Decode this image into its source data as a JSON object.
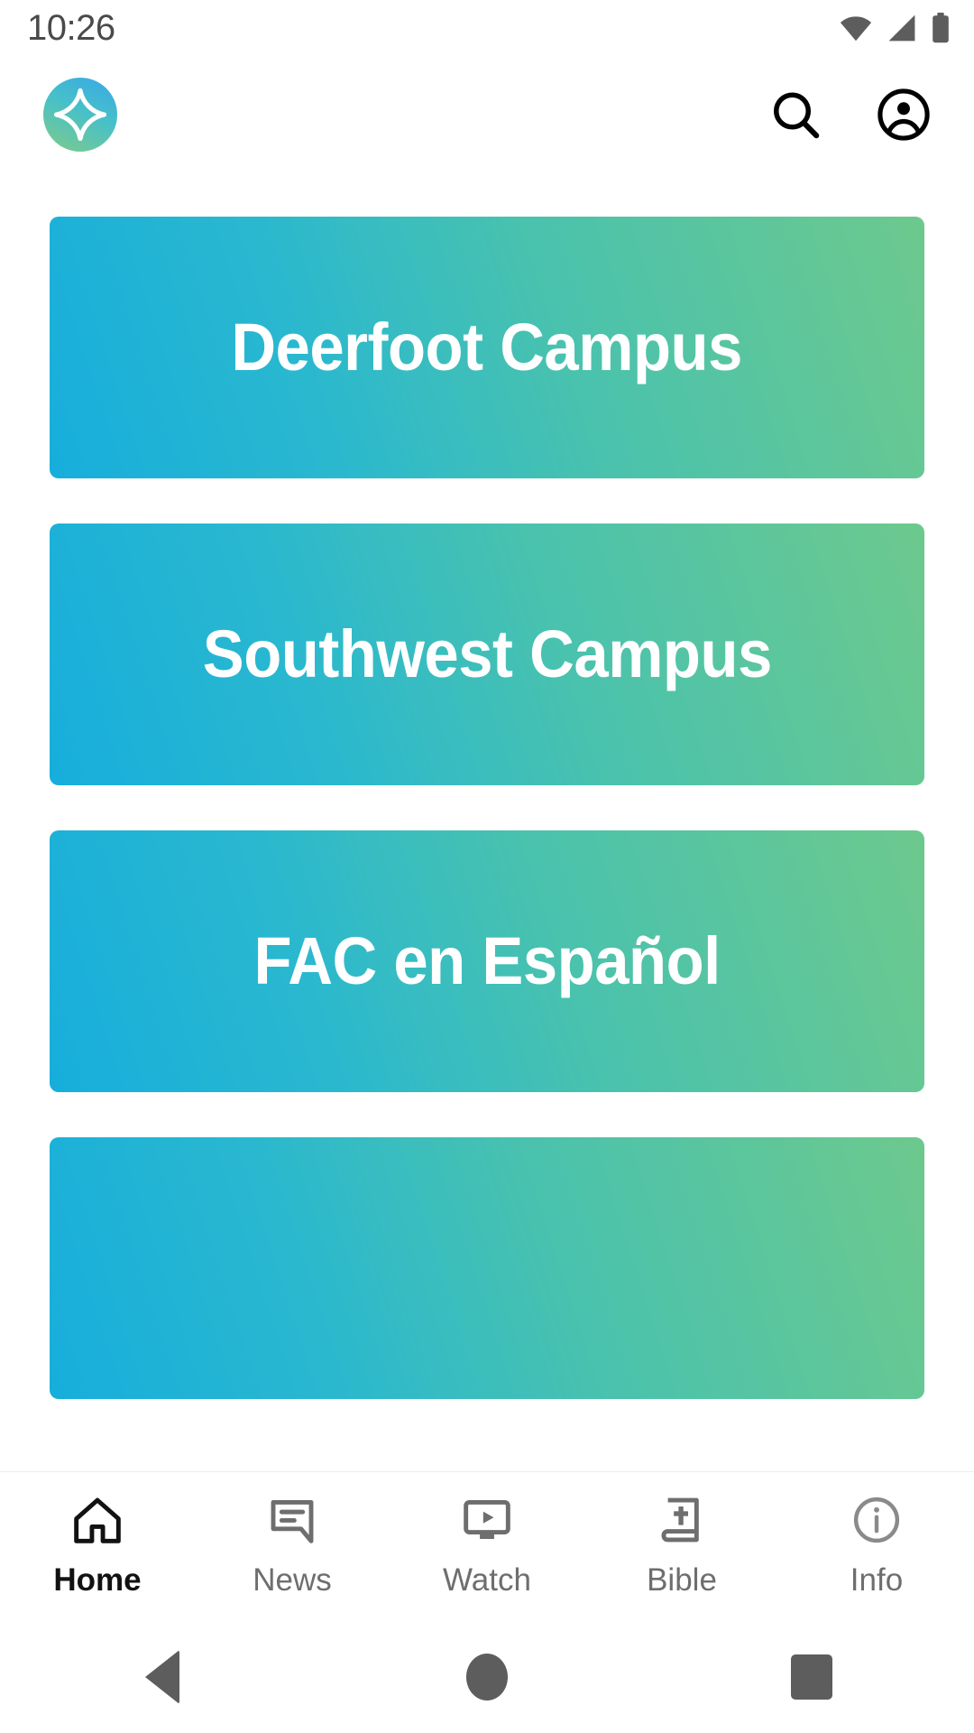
{
  "status_bar": {
    "time": "10:26",
    "icons": [
      {
        "name": "wifi-icon",
        "label": "wifi"
      },
      {
        "name": "cellular-signal-icon",
        "label": "signal"
      },
      {
        "name": "battery-icon",
        "label": "battery"
      }
    ]
  },
  "header": {
    "logo": {
      "name": "app-logo-sparkle",
      "gradient_start": "#37A8E8",
      "gradient_end": "#7FCB8A"
    },
    "actions": [
      {
        "name": "search-icon",
        "label": "Search"
      },
      {
        "name": "account-circle-icon",
        "label": "Account"
      }
    ]
  },
  "main": {
    "cards": [
      {
        "label": "Deerfoot Campus"
      },
      {
        "label": "Southwest Campus"
      },
      {
        "label": "FAC en Español"
      },
      {
        "label": ""
      }
    ],
    "card_gradient": {
      "from": "#17AEDC",
      "to": "#6DC98D"
    }
  },
  "bottom_nav": {
    "items": [
      {
        "label": "Home",
        "icon": "home-icon",
        "active": true
      },
      {
        "label": "News",
        "icon": "news-chat-icon",
        "active": false
      },
      {
        "label": "Watch",
        "icon": "watch-tv-play-icon",
        "active": false
      },
      {
        "label": "Bible",
        "icon": "bible-book-cross-icon",
        "active": false
      },
      {
        "label": "Info",
        "icon": "info-circle-icon",
        "active": false
      }
    ],
    "active_color": "#121212",
    "inactive_color": "#6e6e6e"
  },
  "system_nav": {
    "buttons": [
      {
        "name": "android-back-button",
        "label": "Back"
      },
      {
        "name": "android-home-button",
        "label": "Home"
      },
      {
        "name": "android-recents-button",
        "label": "Recents"
      }
    ]
  }
}
